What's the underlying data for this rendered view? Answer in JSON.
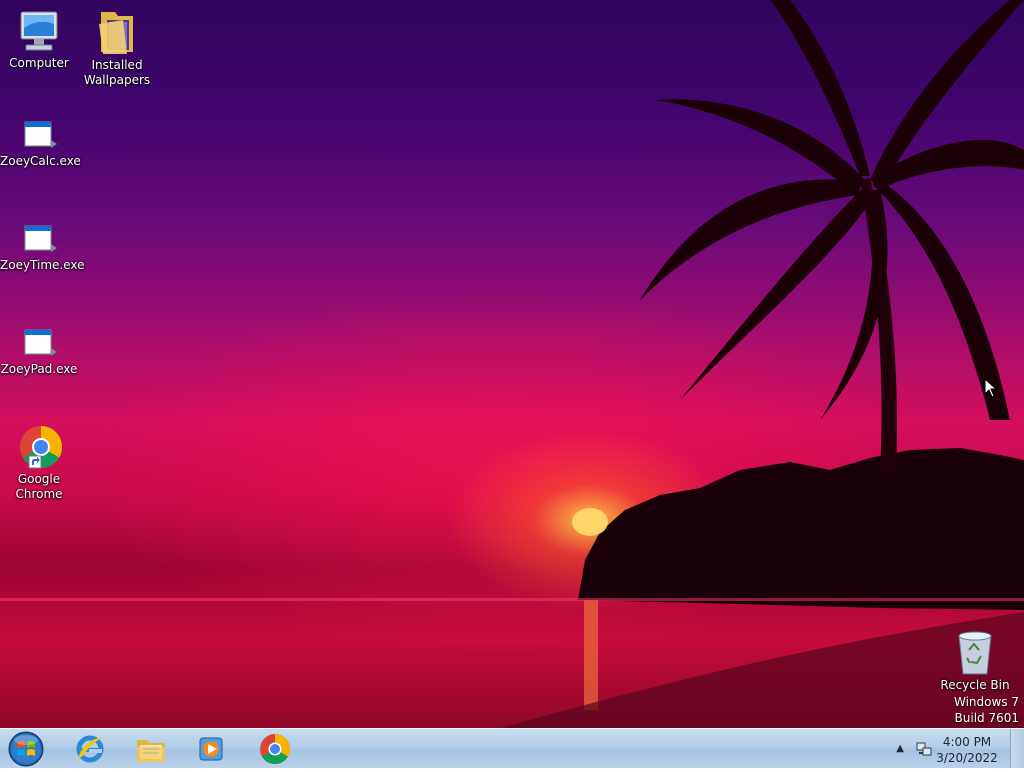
{
  "desktop": {
    "icons": [
      {
        "label": "Computer",
        "icon": "computer-icon"
      },
      {
        "label": "Installed Wallpapers",
        "icon": "folder-icon"
      },
      {
        "label": "ZoeyCalc.exe",
        "icon": "exe-icon"
      },
      {
        "label": "ZoeyTime.exe",
        "icon": "exe-icon"
      },
      {
        "label": "ZoeyPad.exe",
        "icon": "exe-icon"
      },
      {
        "label": "Google Chrome",
        "icon": "chrome-icon"
      },
      {
        "label": "Recycle Bin",
        "icon": "recycle-bin-icon"
      }
    ],
    "watermark": {
      "line1": "Windows 7",
      "line2": "Build 7601"
    }
  },
  "taskbar": {
    "start_icon": "windows-start-orb",
    "pinned": [
      {
        "name": "Internet Explorer",
        "icon": "internet-explorer-icon"
      },
      {
        "name": "Windows Explorer",
        "icon": "file-explorer-icon"
      },
      {
        "name": "Windows Media Player",
        "icon": "media-player-icon"
      },
      {
        "name": "Google Chrome",
        "icon": "chrome-icon"
      }
    ],
    "tray": {
      "arrow": "▲",
      "time": "4:00 PM",
      "date": "3/20/2022"
    }
  },
  "colors": {
    "taskbar": "#b2cde8",
    "sky_top": "#31045e",
    "horizon": "#d40f5c"
  }
}
